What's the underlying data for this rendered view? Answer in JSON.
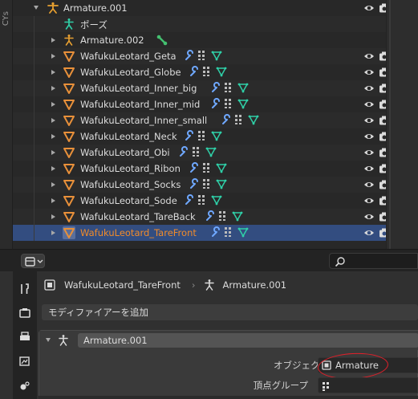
{
  "colors": {
    "outliner_bg": "#282828",
    "selected_row": "#334d80",
    "armature_orange": "#e8a030",
    "mesh_orange": "#e8903a",
    "modifier_blue": "#6fa8ff",
    "vertex_green": "#2fd0a8",
    "bone_green": "#44c070",
    "highlight_red": "#e0202a"
  },
  "outliner": {
    "left_tab_text": "CYs",
    "rows": [
      {
        "label": "Armature.001",
        "icon": "armature-icon",
        "expanded": true
      },
      {
        "label": "ポーズ",
        "icon": "pose-icon"
      },
      {
        "label": "Armature.002",
        "icon": "armature-icon",
        "extra": "bone-icon"
      },
      {
        "label": "WafukuLeotard_Geta",
        "icon": "mesh-icon"
      },
      {
        "label": "WafukuLeotard_Globe",
        "icon": "mesh-icon"
      },
      {
        "label": "WafukuLeotard_Inner_big",
        "icon": "mesh-icon"
      },
      {
        "label": "WafukuLeotard_Inner_mid",
        "icon": "mesh-icon"
      },
      {
        "label": "WafukuLeotard_Inner_small",
        "icon": "mesh-icon"
      },
      {
        "label": "WafukuLeotard_Neck",
        "icon": "mesh-icon"
      },
      {
        "label": "WafukuLeotard_Obi",
        "icon": "mesh-icon"
      },
      {
        "label": "WafukuLeotard_Ribon",
        "icon": "mesh-icon"
      },
      {
        "label": "WafukuLeotard_Socks",
        "icon": "mesh-icon"
      },
      {
        "label": "WafukuLeotard_Sode",
        "icon": "mesh-icon"
      },
      {
        "label": "WafukuLeotard_TareBack",
        "icon": "mesh-icon"
      },
      {
        "label": "WafukuLeotard_TareFront",
        "icon": "mesh-icon",
        "selected": true
      }
    ]
  },
  "properties": {
    "breadcrumb_object": "WafukuLeotard_TareFront",
    "breadcrumb_modifier": "Armature.001",
    "add_modifier": "モディファイアーを追加",
    "modifier_name": "Armature.001",
    "object_label": "オブジェクト",
    "object_value": "Armature",
    "vertex_group_label": "頂点グループ"
  }
}
